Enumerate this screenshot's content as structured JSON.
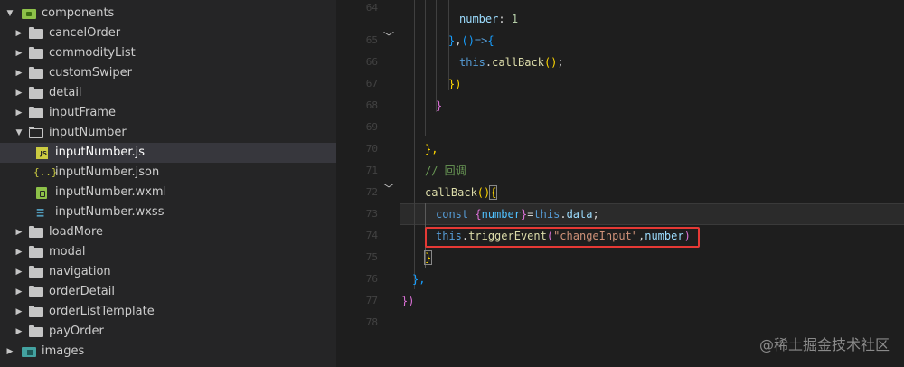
{
  "explorer": {
    "items": [
      {
        "label": "components",
        "type": "folder-green",
        "expanded": true
      },
      {
        "label": "cancelOrder",
        "type": "folder"
      },
      {
        "label": "commodityList",
        "type": "folder"
      },
      {
        "label": "customSwiper",
        "type": "folder"
      },
      {
        "label": "detail",
        "type": "folder"
      },
      {
        "label": "inputFrame",
        "type": "folder"
      },
      {
        "label": "inputNumber",
        "type": "folder",
        "expanded": true
      },
      {
        "label": "inputNumber.js",
        "type": "js-file",
        "selected": true
      },
      {
        "label": "inputNumber.json",
        "type": "json-file"
      },
      {
        "label": "inputNumber.wxml",
        "type": "wxml-file"
      },
      {
        "label": "inputNumber.wxss",
        "type": "wxss-file"
      },
      {
        "label": "loadMore",
        "type": "folder"
      },
      {
        "label": "modal",
        "type": "folder"
      },
      {
        "label": "navigation",
        "type": "folder"
      },
      {
        "label": "orderDetail",
        "type": "folder"
      },
      {
        "label": "orderListTemplate",
        "type": "folder"
      },
      {
        "label": "payOrder",
        "type": "folder"
      },
      {
        "label": "images",
        "type": "folder-image"
      }
    ],
    "icon_glyphs": {
      "js": "JS",
      "json": "{..}",
      "wxss": "≡"
    }
  },
  "editor": {
    "line_numbers": [
      "64",
      "65",
      "66",
      "67",
      "68",
      "69",
      "70",
      "71",
      "72",
      "73",
      "74",
      "75",
      "76",
      "77",
      "78"
    ],
    "lines": {
      "l64": {
        "p1": "number",
        "p2": ": ",
        "p3": "1"
      },
      "l65": {
        "p1": "}",
        "p2": ",",
        "p3": "()",
        "p4": "=>",
        "p5": "{"
      },
      "l66": {
        "p1": "this",
        "p2": ".",
        "p3": "callBack",
        "p4": "()",
        "p5": ";"
      },
      "l67": {
        "p1": "})"
      },
      "l68": {
        "p1": "}"
      },
      "l70": {
        "p1": "},"
      },
      "l71": {
        "p1": "// 回调"
      },
      "l72": {
        "p1": "callBack",
        "p2": "()",
        "p3": "{"
      },
      "l73": {
        "p1": "const ",
        "p2": "{",
        "p3": "number",
        "p4": "}",
        "p5": "=",
        "p6": "this",
        "p7": ".",
        "p8": "data",
        "p9": ";"
      },
      "l74": {
        "p1": "this",
        "p2": ".",
        "p3": "triggerEvent",
        "p4": "(",
        "p5": "\"changeInput\"",
        "p6": ",",
        "p7": "number",
        "p8": ")"
      },
      "l75": {
        "p1": "}"
      },
      "l76": {
        "p1": "},"
      },
      "l77": {
        "p1": "})"
      }
    }
  },
  "watermark": "@稀土掘金技术社区",
  "colors": {
    "highlight_box": "#e53935",
    "selected_row": "#37373d"
  }
}
